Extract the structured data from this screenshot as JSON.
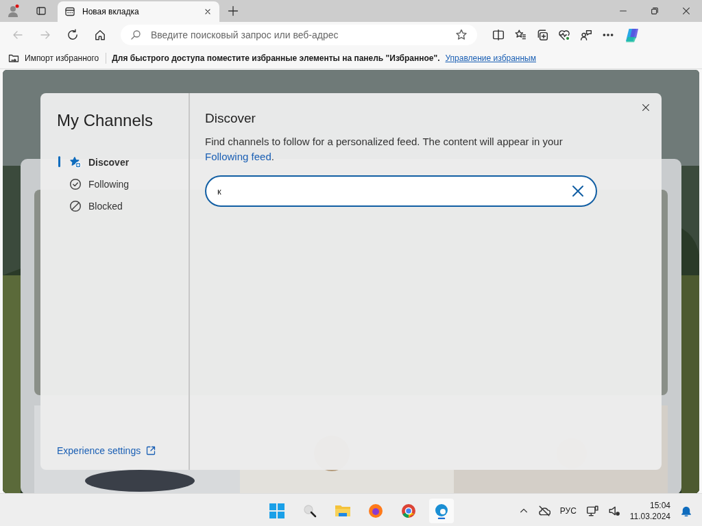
{
  "browser": {
    "tab": {
      "title": "Новая вкладка"
    },
    "address_bar": {
      "placeholder": "Введите поисковый запрос или веб-адрес"
    },
    "favorites_bar": {
      "import": "Импорт избранного",
      "hint": "Для быстрого доступа поместите избранные элементы на панель \"Избранное\".",
      "manage_link": "Управление избранным"
    }
  },
  "dialog": {
    "title": "My Channels",
    "nav": [
      {
        "label": "Discover",
        "kind": "discover",
        "selected": true
      },
      {
        "label": "Following",
        "kind": "following",
        "selected": false
      },
      {
        "label": "Blocked",
        "kind": "blocked",
        "selected": false
      }
    ],
    "settings_link": "Experience settings",
    "heading": "Discover",
    "description": "Find channels to follow for a personalized feed. The content will appear in your",
    "description_link": "Following feed",
    "description_end": ".",
    "search": {
      "value": "к"
    }
  },
  "taskbar": {
    "language": "РУС",
    "time": "15:04",
    "date": "11.03.2024"
  }
}
